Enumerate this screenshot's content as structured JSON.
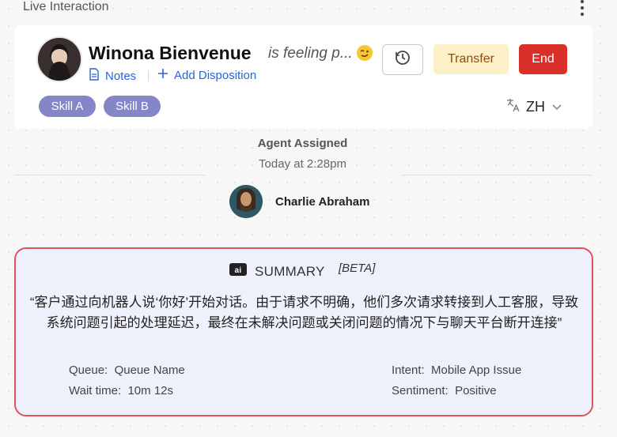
{
  "header": {
    "tab_label": "Live Interaction"
  },
  "contact": {
    "name": "Winona Bienvenue",
    "feeling": "is feeling p...",
    "notes_label": "Notes",
    "add_disposition_label": "Add Disposition",
    "skills": [
      "Skill A",
      "Skill B"
    ],
    "language": "ZH"
  },
  "actions": {
    "transfer_label": "Transfer",
    "end_label": "End"
  },
  "event": {
    "title": "Agent Assigned",
    "time": "Today at 2:28pm",
    "agent_name": "Charlie Abraham"
  },
  "summary": {
    "badge": "ai",
    "title": "SUMMARY",
    "beta": "[BETA]",
    "text": "“客户通过向机器人说‘你好’开始对话。由于请求不明确，他们多次请求转接到人工客服，导致系统问题引起的处理延迟，最终在未解决问题或关闭问题的情况下与聊天平台断开连接”",
    "queue_label": "Queue:",
    "queue_value": "Queue Name",
    "wait_label": "Wait time:",
    "wait_value": "10m 12s",
    "intent_label": "Intent:",
    "intent_value": "Mobile App Issue",
    "sentiment_label": "Sentiment:",
    "sentiment_value": "Positive"
  },
  "colors": {
    "accent_link": "#2a64d6",
    "end_button": "#d9312a",
    "transfer_bg": "#fdefc7",
    "skill_bg": "#8586c8",
    "summary_border": "#e0535b"
  },
  "icons": [
    "notes-icon",
    "plus-icon",
    "history-icon",
    "translate-icon",
    "chevron-down-icon",
    "ai-icon",
    "more-vertical-icon",
    "wink-emoji-icon"
  ]
}
